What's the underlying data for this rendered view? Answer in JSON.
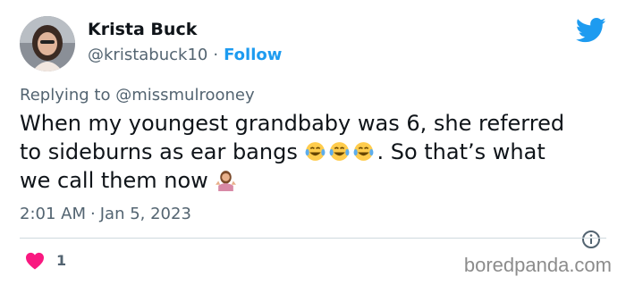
{
  "author": {
    "name": "Krista Buck",
    "handle": "@kristabuck10",
    "separator": "·",
    "follow_label": "Follow",
    "avatar_icon": "avatar-photo"
  },
  "reply": {
    "prefix": "Replying to",
    "mention": "@missmulrooney"
  },
  "tweet": {
    "line1": "When my youngest grandbaby was 6, she referred",
    "line2_a": "to sideburns as ear bangs",
    "line2_b": ". So that’s what",
    "line3": "we call them now",
    "emojis": [
      "face-with-tears-of-joy",
      "face-with-tears-of-joy",
      "face-with-tears-of-joy",
      "woman-shrugging"
    ]
  },
  "meta": {
    "time": "2:01 AM",
    "separator": "·",
    "date": "Jan 5, 2023"
  },
  "actions": {
    "likes": "1"
  },
  "brand": {
    "twitter_icon": "twitter-bird-icon",
    "watermark": "boredpanda.com"
  },
  "colors": {
    "accent": "#1d9bf0",
    "heart": "#f91880",
    "muted": "#536471",
    "text": "#0f1419",
    "divider": "#cfd9de"
  }
}
